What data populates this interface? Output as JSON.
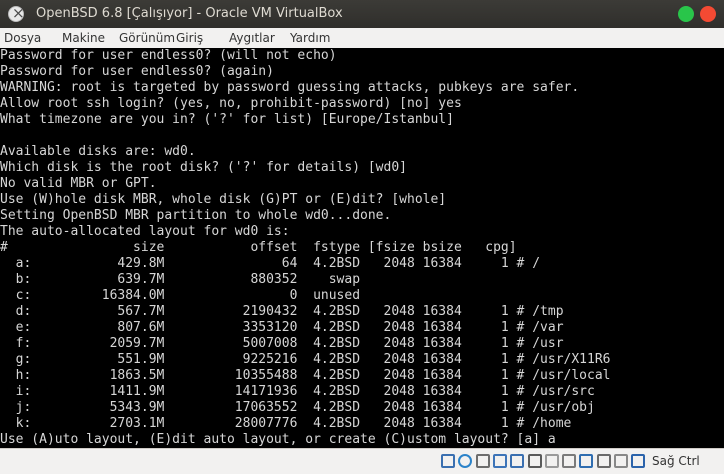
{
  "window": {
    "title": "OpenBSD 6.8 [Çalışıyor] - Oracle VM VirtualBox"
  },
  "menu": {
    "items": [
      "Dosya",
      "Makine",
      "Görünüm",
      "Giriş",
      "Aygıtlar",
      "Yardım"
    ]
  },
  "console": {
    "lines": [
      "Password for user endless0? (will not echo)",
      "Password for user endless0? (again)",
      "WARNING: root is targeted by password guessing attacks, pubkeys are safer.",
      "Allow root ssh login? (yes, no, prohibit-password) [no] yes",
      "What timezone are you in? ('?' for list) [Europe/Istanbul]",
      "",
      "Available disks are: wd0.",
      "Which disk is the root disk? ('?' for details) [wd0]",
      "No valid MBR or GPT.",
      "Use (W)hole disk MBR, whole disk (G)PT or (E)dit? [whole]",
      "Setting OpenBSD MBR partition to whole wd0...done.",
      "The auto-allocated layout for wd0 is:",
      "#                size           offset  fstype [fsize bsize   cpg]",
      "  a:           429.8M               64  4.2BSD   2048 16384     1 # /",
      "  b:           639.7M           880352    swap",
      "  c:         16384.0M                0  unused",
      "  d:           567.7M          2190432  4.2BSD   2048 16384     1 # /tmp",
      "  e:           807.6M          3353120  4.2BSD   2048 16384     1 # /var",
      "  f:          2059.7M          5007008  4.2BSD   2048 16384     1 # /usr",
      "  g:           551.9M          9225216  4.2BSD   2048 16384     1 # /usr/X11R6",
      "  h:          1863.5M         10355488  4.2BSD   2048 16384     1 # /usr/local",
      "  i:          1411.9M         14171936  4.2BSD   2048 16384     1 # /usr/src",
      "  j:          5343.9M         17063552  4.2BSD   2048 16384     1 # /usr/obj",
      "  k:          2703.1M         28007776  4.2BSD   2048 16384     1 # /home",
      "Use (A)uto layout, (E)dit auto layout, or create (C)ustom layout? [a] a"
    ]
  },
  "statusbar": {
    "host_key_label": "Sağ Ctrl",
    "icons": [
      {
        "name": "hard-disk-icon",
        "color": "#3a6fb0"
      },
      {
        "name": "optical-disk-icon",
        "color": "#2c83c9"
      },
      {
        "name": "audio-icon",
        "color": "#6d6d6d"
      },
      {
        "name": "network-icon",
        "color": "#3d74b8"
      },
      {
        "name": "usb-icon",
        "color": "#3a6fb0"
      },
      {
        "name": "shared-folders-icon",
        "color": "#5a5a5a"
      },
      {
        "name": "display-icon",
        "color": "#9a9a9a"
      },
      {
        "name": "video-capture-icon",
        "color": "#7a7a7a"
      },
      {
        "name": "guest-additions-icon",
        "color": "#2f6db0"
      },
      {
        "name": "cpu-icon",
        "color": "#6a6a6a"
      },
      {
        "name": "mouse-integration-icon",
        "color": "#888888"
      },
      {
        "name": "keyboard-icon",
        "color": "#2b63ab"
      }
    ]
  }
}
